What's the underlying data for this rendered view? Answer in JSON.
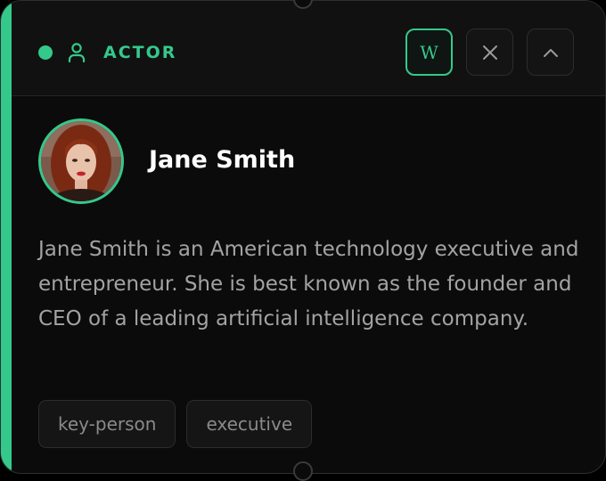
{
  "entity": {
    "type_label": "ACTOR",
    "name": "Jane Smith",
    "description": "Jane Smith is an American technology executive and entrepreneur. She is best known as the founder and CEO of a leading artificial intelligence company.",
    "tags": [
      "key-person",
      "executive"
    ]
  },
  "header": {
    "wiki_button_label": "W",
    "close_icon": "close-icon",
    "collapse_icon": "chevron-up-icon",
    "type_icon": "user-icon"
  },
  "colors": {
    "accent": "#34c98b",
    "background": "#0b0b0b",
    "header_background": "#111111",
    "name_text": "#ffffff",
    "description_text": "#a3a3a3",
    "tag_text": "#8a8a8a"
  }
}
